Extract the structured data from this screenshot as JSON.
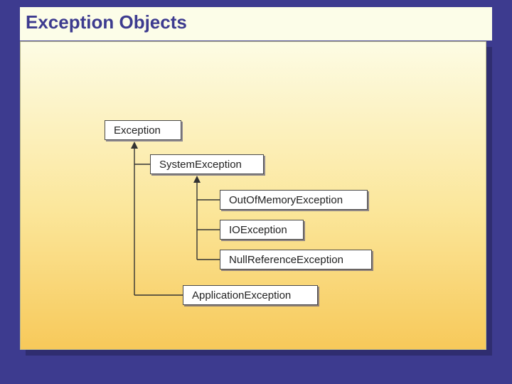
{
  "title": "Exception Objects",
  "nodes": {
    "exception": "Exception",
    "system_exception": "SystemException",
    "out_of_memory": "OutOfMemoryException",
    "io_exception": "IOException",
    "null_reference": "NullReferenceException",
    "application_exception": "ApplicationException"
  },
  "hierarchy": {
    "root": "Exception",
    "children": [
      {
        "name": "SystemException",
        "children": [
          {
            "name": "OutOfMemoryException"
          },
          {
            "name": "IOException"
          },
          {
            "name": "NullReferenceException"
          }
        ]
      },
      {
        "name": "ApplicationException"
      }
    ]
  },
  "colors": {
    "background": "#3d3b8f",
    "panel_gradient_top": "#fdfce4",
    "panel_gradient_bottom": "#f7c95a",
    "node_fill": "#ffffff",
    "node_border": "#4a4a4a"
  }
}
